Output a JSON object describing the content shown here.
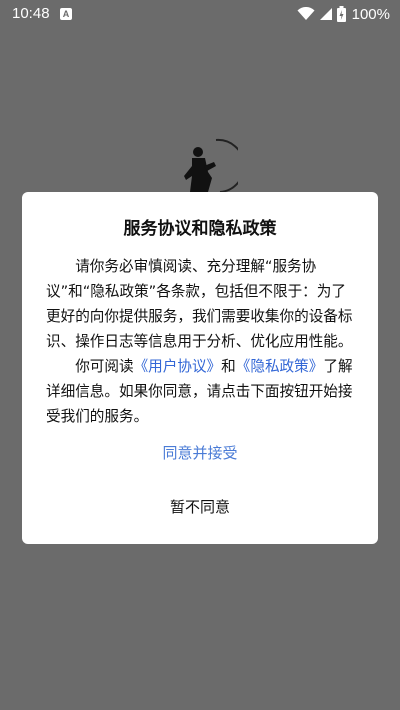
{
  "status_bar": {
    "time": "10:48",
    "battery": "100%",
    "icons": [
      "notification-a-icon",
      "wifi-icon",
      "signal-icon",
      "battery-charging-icon"
    ]
  },
  "dialog": {
    "title": "服务协议和隐私政策",
    "paragraph1": "请你务必审慎阅读、充分理解“服务协议”和“隐私政策”各条款，包括但不限于：为了更好的向你提供服务，我们需要收集你的设备标识、操作日志等信息用于分析、优化应用性能。",
    "paragraph2_prefix": "你可阅读",
    "user_agreement_link": "《用户协议》",
    "and_text": "和",
    "privacy_policy_link": "《隐私政策》",
    "paragraph2_suffix": "了解详细信息。如果你同意，请点击下面按钮开始接受我们的服务。",
    "accept_label": "同意并接受",
    "decline_label": "暂不同意"
  },
  "colors": {
    "overlay": "#6b6b6b",
    "link": "#3367d6",
    "accept": "#4a7bd6"
  }
}
